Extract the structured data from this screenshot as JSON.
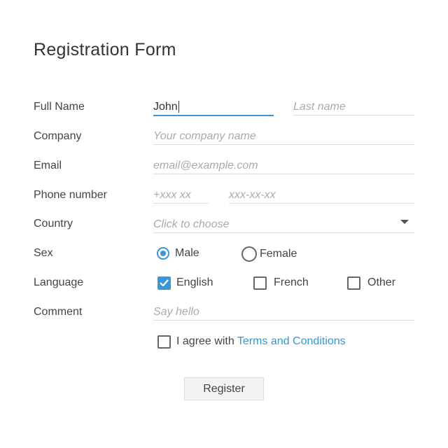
{
  "title": "Registration Form",
  "labels": {
    "full_name": "Full Name",
    "company": "Company",
    "email": "Email",
    "phone": "Phone number",
    "country": "Country",
    "sex": "Sex",
    "language": "Language",
    "comment": "Comment"
  },
  "fields": {
    "first_name": {
      "value": "John"
    },
    "last_name": {
      "placeholder": "Last name"
    },
    "company": {
      "placeholder": "Your company name"
    },
    "email": {
      "placeholder": "email@example.com"
    },
    "phone_code": {
      "placeholder": "+xxx xx"
    },
    "phone_number": {
      "placeholder": "xxx-xx-xx"
    },
    "country": {
      "placeholder": "Click to choose"
    },
    "comment": {
      "placeholder": "Say hello"
    }
  },
  "sex": [
    {
      "label": "Male",
      "selected": true
    },
    {
      "label": "Female",
      "selected": false
    }
  ],
  "languages": [
    {
      "label": "English",
      "checked": true
    },
    {
      "label": "French",
      "checked": false
    },
    {
      "label": "Other",
      "checked": false
    }
  ],
  "agree": {
    "text": "I agree with",
    "link": "Terms and Conditions",
    "checked": false
  },
  "register_label": "Register",
  "accent": "#3498db"
}
